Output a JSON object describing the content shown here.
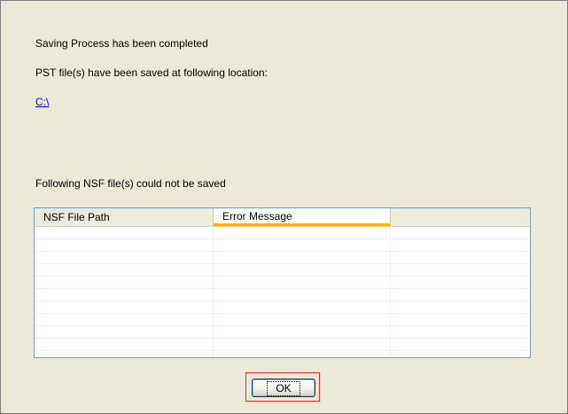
{
  "dialog": {
    "message_complete": "Saving Process has been completed",
    "message_saved_at": "PST file(s) have been saved at following location:",
    "saved_path": "C:\\",
    "message_not_saved": "Following NSF file(s) could not be saved"
  },
  "failed_list": {
    "columns": [
      "NSF File Path",
      "Error Message",
      ""
    ],
    "rows": []
  },
  "buttons": {
    "ok_label": "OK"
  },
  "colors": {
    "dialog_background": "#ECE9D8",
    "link": "#0000EE",
    "header_hot_track": "#F9B11E",
    "highlight_frame": "#E03030"
  }
}
